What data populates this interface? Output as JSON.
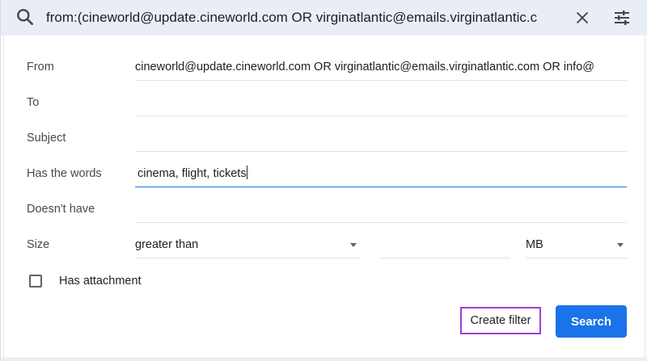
{
  "search_bar": {
    "query": "from:(cineworld@update.cineworld.com OR virginatlantic@emails.virginatlantic.c",
    "search_icon": "search-icon",
    "close_icon": "close-icon",
    "options_icon": "tune-icon"
  },
  "form": {
    "from": {
      "label": "From",
      "value": "cineworld@update.cineworld.com OR virginatlantic@emails.virginatlantic.com OR info@"
    },
    "to": {
      "label": "To",
      "value": ""
    },
    "subject": {
      "label": "Subject",
      "value": ""
    },
    "has_words": {
      "label": "Has the words",
      "value": "cinema, flight, tickets"
    },
    "doesnt_have": {
      "label": "Doesn't have",
      "value": ""
    },
    "size": {
      "label": "Size",
      "operator": "greater than",
      "number": "",
      "unit": "MB"
    },
    "has_attachment": {
      "label": "Has attachment",
      "checked": false
    }
  },
  "actions": {
    "create_filter_label": "Create filter",
    "search_label": "Search"
  },
  "colors": {
    "accent": "#1a73e8",
    "highlight": "#a33bd5",
    "search_bar_bg": "#e9eef6"
  }
}
